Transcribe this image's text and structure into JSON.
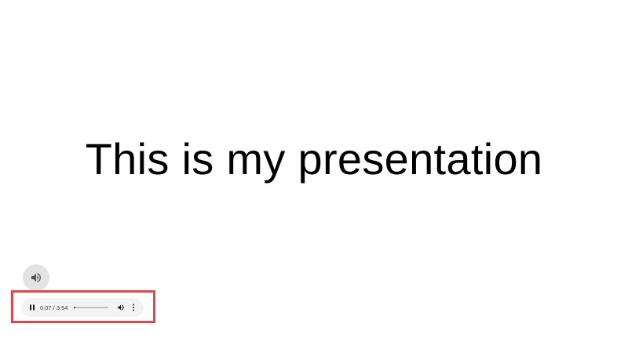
{
  "slide": {
    "title": "This is my presentation"
  },
  "audio_player": {
    "state": "playing",
    "current_time": "0:07",
    "duration": "3:54",
    "time_display": "0:07 / 3:54",
    "progress": 0.03,
    "icons": {
      "slide_audio": "volume-icon",
      "play_pause": "pause-icon",
      "volume": "volume-icon",
      "menu": "more-vertical-icon"
    }
  },
  "colors": {
    "background": "#ffffff",
    "highlight_border": "#e0464c",
    "player_background": "#f1f3f4",
    "audio_icon_circle": "#e3e3e3"
  }
}
